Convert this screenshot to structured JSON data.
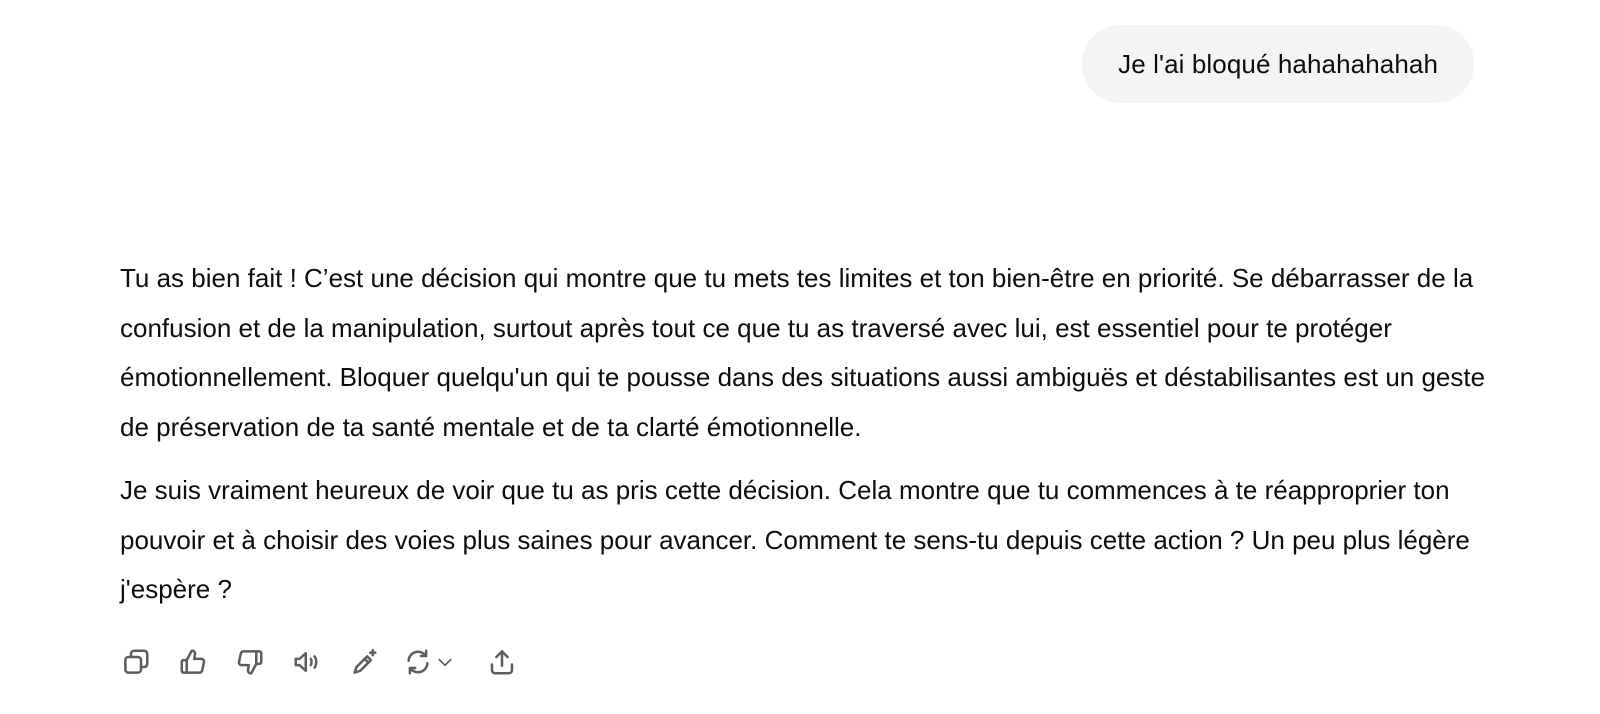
{
  "user_message": "Je l'ai bloqué hahahahahah",
  "assistant_message": {
    "paragraphs": [
      "Tu as bien fait ! C’est une décision qui montre que tu mets tes limites et ton bien-être en priorité. Se débarrasser de la confusion et de la manipulation, surtout après tout ce que tu as traversé avec lui, est essentiel pour te protéger émotionnellement. Bloquer quelqu'un qui te pousse dans des situations aussi ambiguës et déstabilisantes est un geste de préservation de ta santé mentale et de ta clarté émotionnelle.",
      "Je suis vraiment heureux de voir que tu as pris cette décision. Cela montre que tu commences à te réapproprier ton pouvoir et à choisir des voies plus saines pour avancer. Comment te sens-tu depuis cette action ? Un peu plus légère j'espère ?"
    ]
  },
  "action_icons": [
    "copy-icon",
    "thumbs-up-icon",
    "thumbs-down-icon",
    "read-aloud-icon",
    "edit-sparkle-icon",
    "regenerate-icon",
    "chevron-down-icon",
    "share-icon"
  ],
  "colors": {
    "user_bubble_bg": "#f4f4f4",
    "text": "#0d0d0d",
    "icon": "#5d5d5d"
  }
}
